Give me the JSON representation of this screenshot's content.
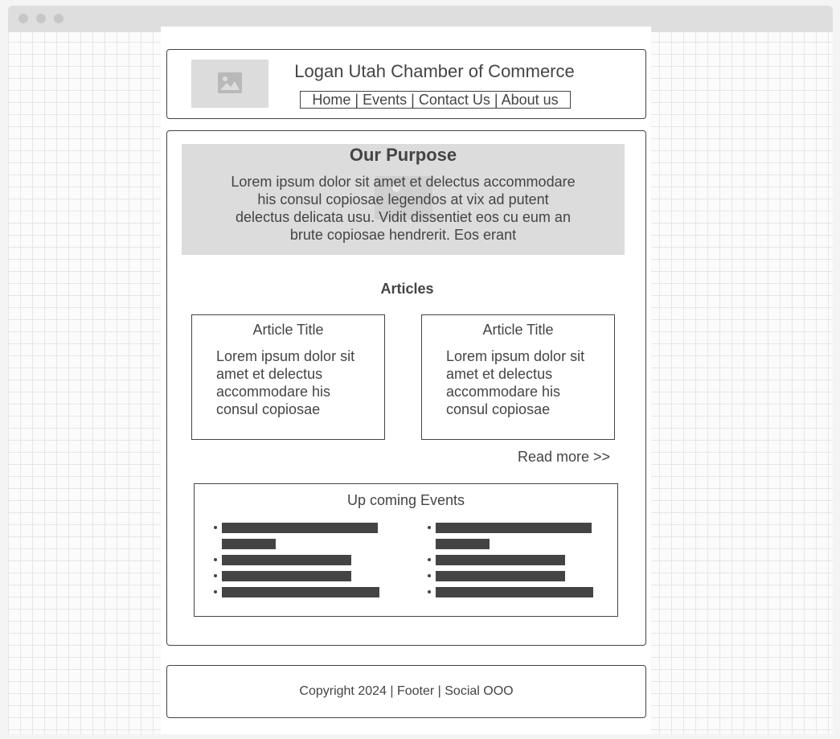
{
  "header": {
    "logo_icon": "image-placeholder-icon",
    "title": "Logan Utah Chamber of Commerce",
    "nav": [
      "Home",
      "Events",
      "Contact Us",
      "About us"
    ],
    "nav_separator": "|"
  },
  "hero": {
    "title": "Our Purpose",
    "text": "Lorem ipsum dolor sit amet et delectus accommodare his consul copiosae legendos at vix ad putent delectus delicata usu. Vidit dissentiet eos cu eum an brute copiosae hendrerit. Eos erant",
    "background_icon": "video-placeholder-icon"
  },
  "articles": {
    "heading": "Articles",
    "items": [
      {
        "title": "Article Title",
        "body": "Lorem ipsum dolor sit amet et delectus accommodare his consul copiosae"
      },
      {
        "title": "Article Title",
        "body": "Lorem ipsum dolor sit amet et delectus accommodare his consul copiosae"
      }
    ],
    "read_more": "Read more >>"
  },
  "events": {
    "title": "Up coming Events"
  },
  "footer": {
    "text": "Copyright 2024 | Footer | Social OOO"
  }
}
